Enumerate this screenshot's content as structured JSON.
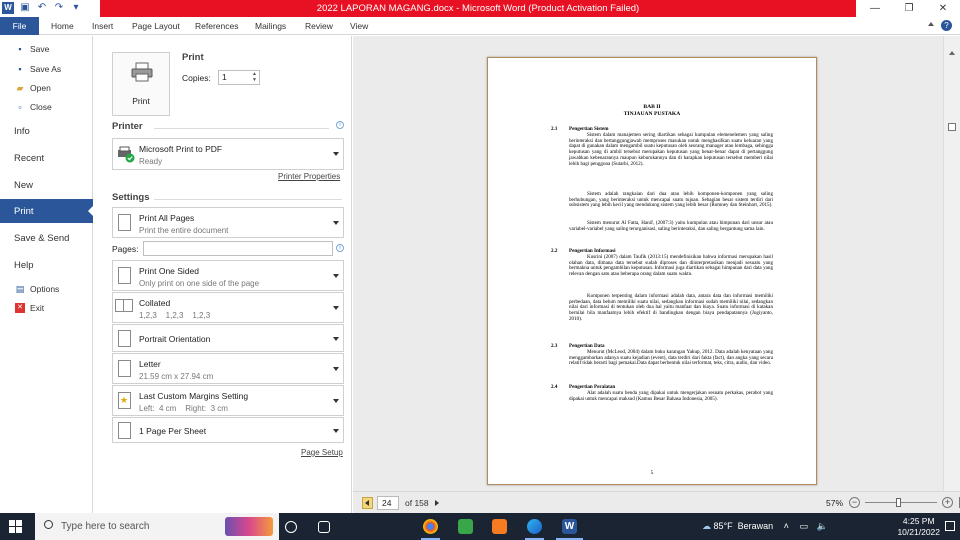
{
  "window": {
    "title": "2022 LAPORAN MAGANG.docx - Microsoft Word (Product Activation Failed)",
    "controls": [
      "minimize",
      "restore",
      "close"
    ]
  },
  "ribbon": {
    "tabs": [
      "File",
      "Home",
      "Insert",
      "Page Layout",
      "References",
      "Mailings",
      "Review",
      "View"
    ]
  },
  "backstage": {
    "items": [
      {
        "label": "Save",
        "icon": "save-icon"
      },
      {
        "label": "Save As",
        "icon": "save-as-icon"
      },
      {
        "label": "Open",
        "icon": "folder-open-icon"
      },
      {
        "label": "Close",
        "icon": "close-doc-icon"
      },
      {
        "label": "Info"
      },
      {
        "label": "Recent"
      },
      {
        "label": "New"
      },
      {
        "label": "Print",
        "active": true
      },
      {
        "label": "Save & Send"
      },
      {
        "label": "Help"
      },
      {
        "label": "Options",
        "icon": "options-icon"
      },
      {
        "label": "Exit",
        "icon": "exit-icon"
      }
    ]
  },
  "print": {
    "button_label": "Print",
    "heading": "Print",
    "copies_label": "Copies:",
    "copies_value": "1",
    "printer_heading": "Printer",
    "printer_name": "Microsoft Print to PDF",
    "printer_status": "Ready",
    "printer_properties": "Printer Properties",
    "settings_heading": "Settings",
    "range_title": "Print All Pages",
    "range_sub": "Print the entire document",
    "pages_label": "Pages:",
    "pages_value": "",
    "sides_title": "Print One Sided",
    "sides_sub": "Only print on one side of the page",
    "collate_title": "Collated",
    "collate_sub": "1,2,3    1,2,3    1,2,3",
    "orientation_title": "Portrait Orientation",
    "paper_title": "Letter",
    "paper_sub": "21.59 cm x 27.94 cm",
    "margins_title": "Last Custom Margins Setting",
    "margins_sub": "Left:  4 cm    Right:  3 cm",
    "pps_title": "1 Page Per Sheet",
    "page_setup": "Page Setup"
  },
  "document": {
    "chapter": "BAB II",
    "chapter_title": "TINJAUAN PUSTAKA",
    "sections": [
      {
        "num": "2.1",
        "title": "Pengertian Sistem",
        "paragraphs": [
          "Sistem dalam manajemen sering diartikan sebagai kumpulan elemenelemen yang saling berinteraksi dan bertanggungjawab memproses masukan untuk menghasilkan suatu keluaran yang dapat di gunakan dalam mengambil suatu keputusan oleh seorang manager atau lembaga, sehingga keputusan yang di ambil tersebut merupakan keputusan yang benar-benar dapat di pertanggung jawabkan kebenarannya maupun keburukannya dan di harapkan keputusan tersebut memberi nilai lebih bagi pengguna (Sutarbi, 2012).",
          "Sistem adalah rangkaian dari dua atau lebih komponen-komponen yang saling berhubungan, yang berinteraksi untuk mencapai suatu tujuan. Sebagian besar sistem terdiri dari subsistem yang lebih kecil yang mendukung sistem yang lebih besar (Romney dan Steinbart, 2015).",
          "Sistem menurut Al Fatta, Hanif, (2007:3) yaitu kumpulan atau himpunan dari unsur atau variabel-variabel yang saling terorganisasi, saling berinteraksi, dan saling bergantung sama lain."
        ]
      },
      {
        "num": "2.2",
        "title": "Pengertian Informasi",
        "paragraphs": [
          "Kusrini (2007) dalam Taufik (2013:15) mendefinisikan bahwa informasi merupakan hasil olahan data, dimana data tersebut sudah diproses dan diinterpretasikan menjadi sesuatu yang bermakna untuk pengambilan keputusan. Informasi juga diartikan sebagai himpunan dari data yang relevan dengan satu atau beberapa orang dalam suatu waktu.",
          "Komponen terpenting dalam informasi adalah data, antara data dan informasi memiliki perbedaan, data belum memiliki suatu nilai, sedangkan informasi sudah memiliki nilai, sedangkan nilai dari informasi di tentukan oleh dua hal yaitu manfaat dan biaya. Suatu informasi di katakan bernilai bila manfaatnya lebih efektif di bandingkan dengan biaya pendapatannya (Jogiyanto, 2010)."
        ]
      },
      {
        "num": "2.3",
        "title": "Pengertian Data",
        "paragraphs": [
          "Menurut (McLeod, 2004) dalam buku karangan Yakup, 2012. Data adalah kenyataan yang menggambarkan adanya suatu kejadian (event), data terdiri dari fakta (fact), dan angka yang secara relatif tidak berarti bagi pemakai.Data dapat berbentuk nilai terformat, teks, citra, audio, dan video."
        ]
      },
      {
        "num": "2.4",
        "title": "Pengertian Peralatan",
        "paragraphs": [
          "Alat adalah suatu benda yang dipakai untuk mengerjakan sesuatu perkakas, perabot yang dipakai untuk mencapai maksud (Kamus Besar Bahasa Indonesia, 2005)."
        ]
      }
    ],
    "page_number": "5"
  },
  "preview_nav": {
    "current_page": "24",
    "of_text": "of 158",
    "zoom": "57%",
    "zoom_fraction": 0.46
  },
  "taskbar": {
    "search_placeholder": "Type here to search",
    "weather": "85°F  Berawan",
    "time": "4:25 PM",
    "date": "10/21/2022",
    "apps": [
      "task-view-icon",
      "widgets-icon",
      "chrome-icon",
      "green-app-icon",
      "xampp-icon",
      "edge-icon",
      "word-icon"
    ]
  }
}
